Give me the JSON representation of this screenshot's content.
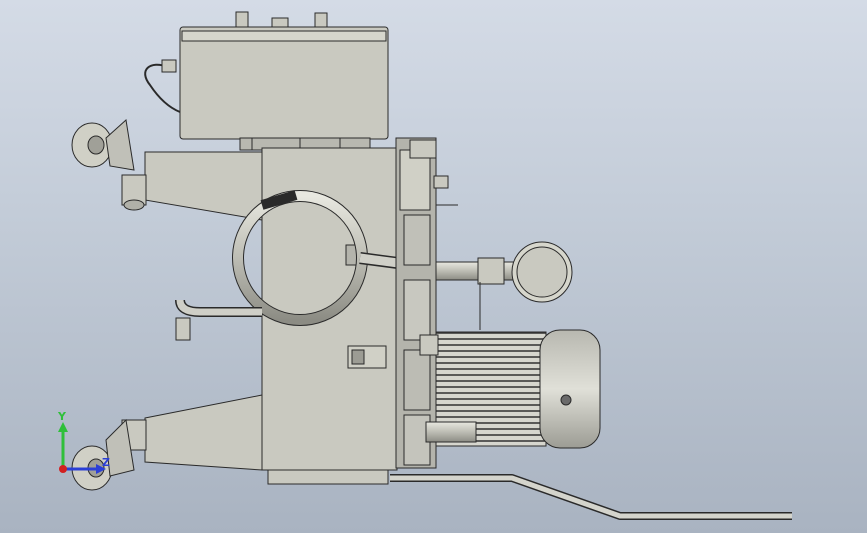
{
  "viewport": {
    "background_top": "#d4dbe6",
    "background_bottom": "#a9b3c1",
    "model_fill": "#c9c9c0",
    "model_edge": "#2a2a2a"
  },
  "triad": {
    "y_label": "Y",
    "z_label": "Z",
    "y_color": "#2fbf3a",
    "z_color": "#2b3fd6",
    "x_color": "#d22020"
  }
}
